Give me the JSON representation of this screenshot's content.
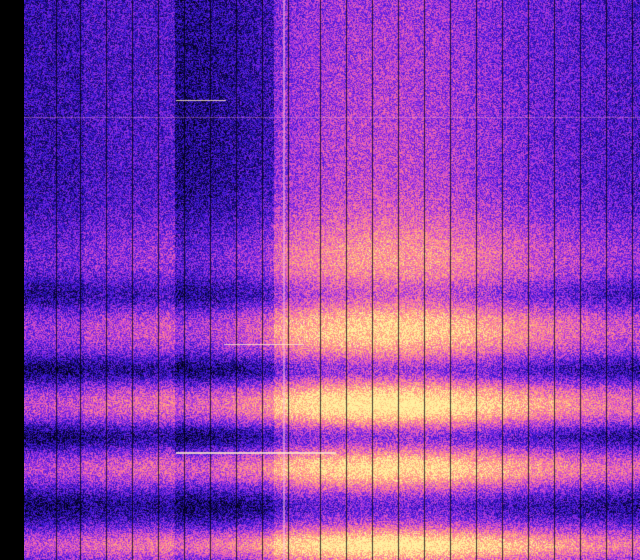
{
  "palette": {
    "stops": [
      "#000014",
      "#1a0a7a",
      "#3c18d8",
      "#8a2be2",
      "#d14fd0",
      "#ff7a9a",
      "#ffb07a",
      "#fff1a0"
    ]
  }
}
